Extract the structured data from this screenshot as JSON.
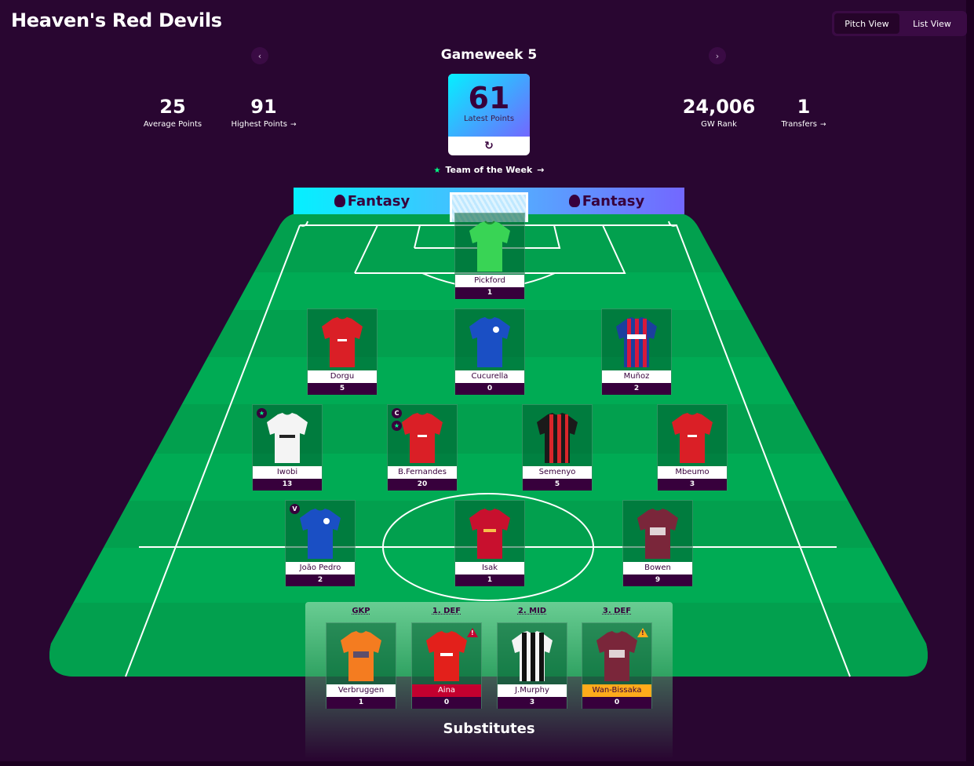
{
  "team_name": "Heaven's Red Devils",
  "view_toggle": {
    "pitch": "Pitch View",
    "list": "List View"
  },
  "gameweek": {
    "title": "Gameweek 5",
    "prev_icon": "chevron-left-icon",
    "next_icon": "chevron-right-icon"
  },
  "stats": {
    "average": {
      "value": "25",
      "label": "Average Points"
    },
    "highest": {
      "value": "91",
      "label": "Highest Points"
    },
    "latest": {
      "value": "61",
      "label": "Latest Points"
    },
    "rank": {
      "value": "24,006",
      "label": "GW Rank"
    },
    "transfers": {
      "value": "1",
      "label": "Transfers"
    }
  },
  "team_of_week": "Team of the Week",
  "banner_text": "Fantasy",
  "colors": {
    "brand_purple": "#37003c",
    "pitch_green": "#00a550",
    "accent_cyan": "#05f0ff",
    "accent_green": "#00ff87"
  },
  "players": {
    "pickford": {
      "name": "Pickford",
      "points": "1"
    },
    "dorgu": {
      "name": "Dorgu",
      "points": "5"
    },
    "cucurella": {
      "name": "Cucurella",
      "points": "0"
    },
    "munoz": {
      "name": "Muñoz",
      "points": "2"
    },
    "iwobi": {
      "name": "Iwobi",
      "points": "13"
    },
    "fernandes": {
      "name": "B.Fernandes",
      "points": "20",
      "captain": "C"
    },
    "semenyo": {
      "name": "Semenyo",
      "points": "5"
    },
    "mbeumo": {
      "name": "Mbeumo",
      "points": "3"
    },
    "joaopedro": {
      "name": "João Pedro",
      "points": "2",
      "vice": "V"
    },
    "isak": {
      "name": "Isak",
      "points": "1"
    },
    "bowen": {
      "name": "Bowen",
      "points": "9"
    }
  },
  "substitutes": {
    "title": "Substitutes",
    "positions": [
      "GKP",
      "1. DEF",
      "2. MID",
      "3. DEF"
    ],
    "players": [
      {
        "name": "Verbruggen",
        "points": "1"
      },
      {
        "name": "Aina",
        "points": "0"
      },
      {
        "name": "J.Murphy",
        "points": "3"
      },
      {
        "name": "Wan-Bissaka",
        "points": "0"
      }
    ]
  }
}
